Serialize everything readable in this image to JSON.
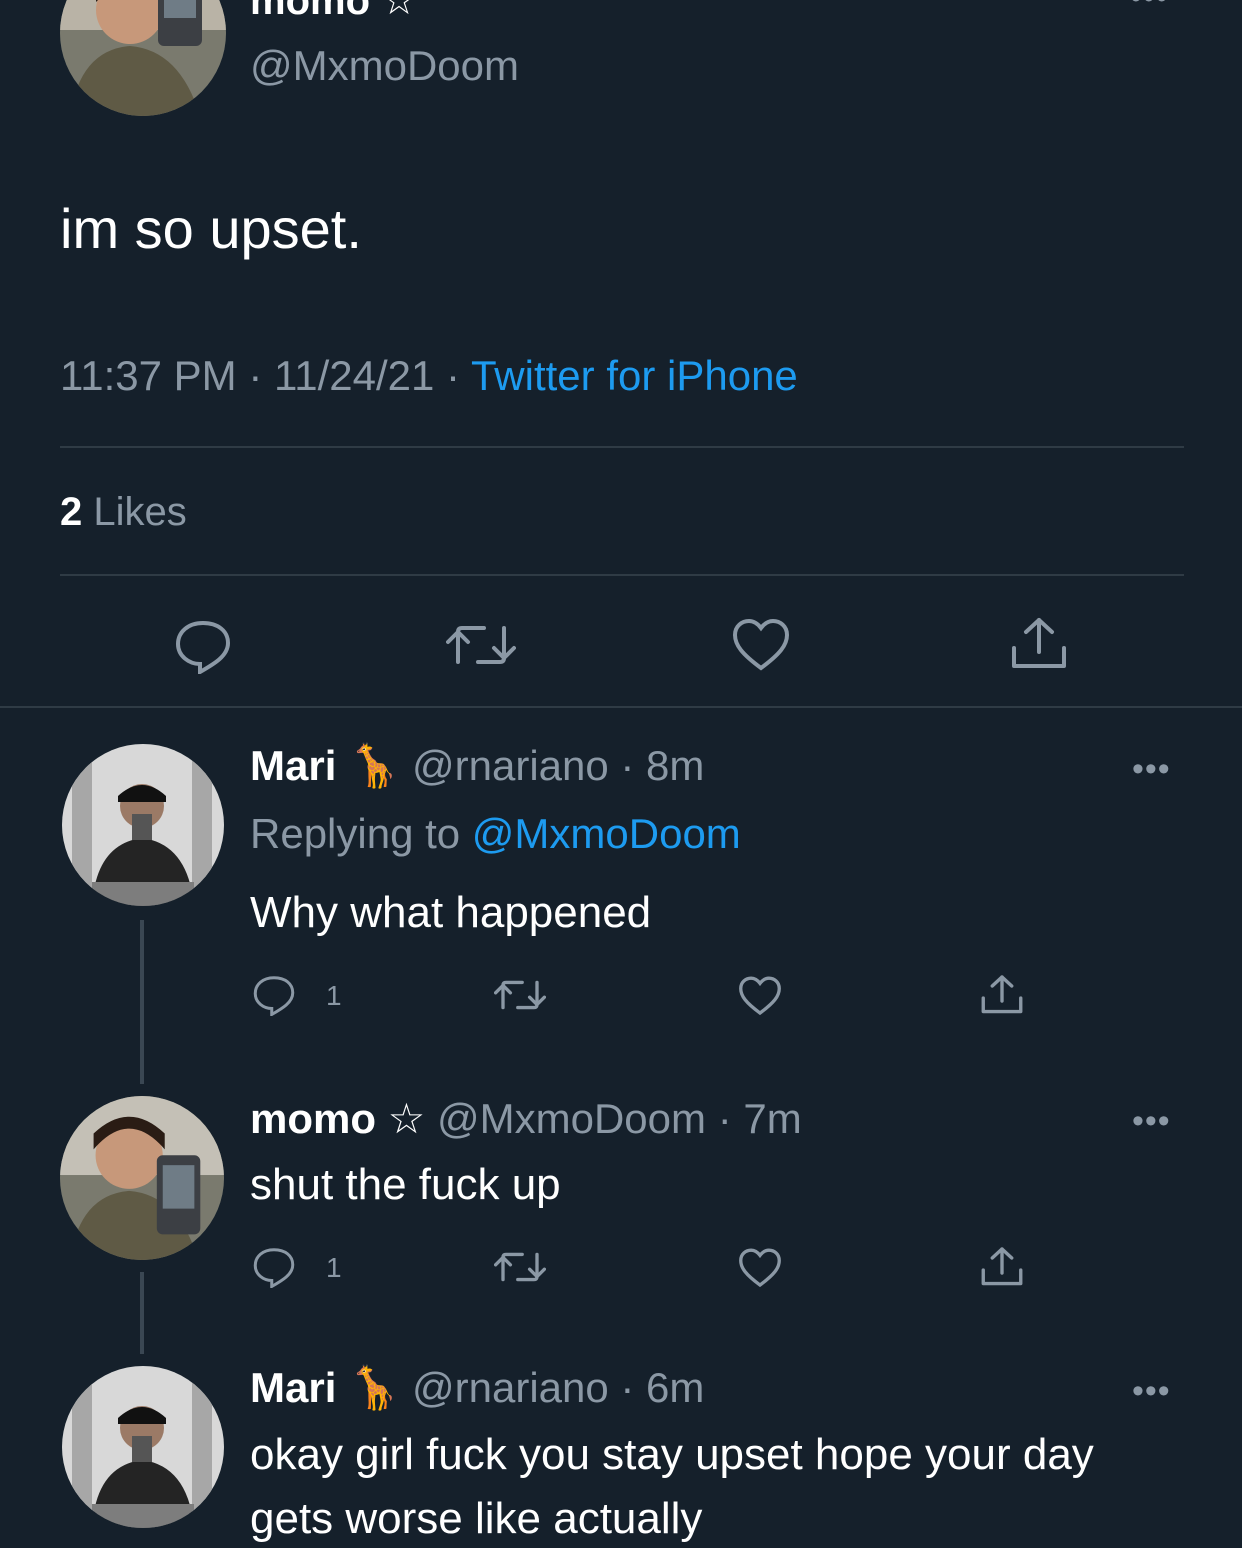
{
  "main_tweet": {
    "display_name_fragment": "momo ☆",
    "handle": "@MxmoDoom",
    "text": "im so upset.",
    "time": "11:37 PM",
    "date": "11/24/21",
    "separator": "·",
    "source": "Twitter for iPhone",
    "likes_count": "2",
    "likes_label": "Likes"
  },
  "replies": [
    {
      "name": "Mari",
      "emoji": "🦒",
      "handle": "@rnariano",
      "time": "· 8m",
      "replying_prefix": "Replying to",
      "replying_to": "@MxmoDoom",
      "text": "Why what happened",
      "reply_count": "1"
    },
    {
      "name": "momo",
      "star": "☆",
      "handle": "@MxmoDoom",
      "time": "· 7m",
      "text": "shut the fuck up",
      "reply_count": "1"
    },
    {
      "name": "Mari",
      "emoji": "🦒",
      "handle": "@rnariano",
      "time": "· 6m",
      "text_line1": "okay girl fuck you stay upset hope your day",
      "text_line2": "gets worse like actually"
    }
  ],
  "ui": {
    "more_glyph": "•••",
    "colors": {
      "background": "#15202b",
      "link": "#1d9bf0",
      "muted": "#8b98a5"
    },
    "icons": [
      "reply-icon",
      "retweet-icon",
      "like-icon",
      "share-icon",
      "more-icon",
      "avatar"
    ]
  }
}
